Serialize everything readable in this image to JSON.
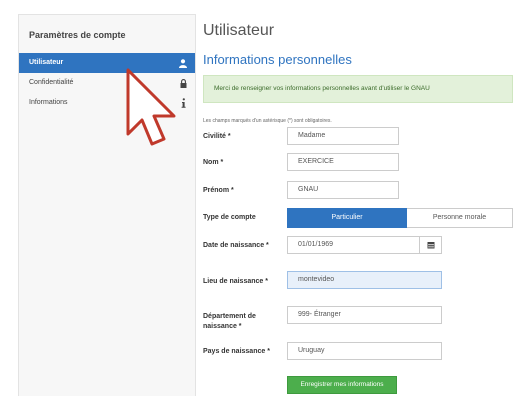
{
  "sidebar": {
    "title": "Paramètres de compte",
    "items": [
      {
        "label": "Utilisateur",
        "icon": "user-icon",
        "active": true
      },
      {
        "label": "Confidentialité",
        "icon": "lock-icon",
        "active": false
      },
      {
        "label": "Informations",
        "icon": "info-icon",
        "active": false
      }
    ]
  },
  "main": {
    "title": "Utilisateur",
    "section": "Informations personnelles",
    "alert": "Merci de renseigner vos informations personnelles avant d'utiliser le GNAU",
    "required_note": "Les champs marqués d'un astérisque (*) sont obligatoires."
  },
  "form": {
    "civilite": {
      "label": "Civilité *",
      "value": "Madame"
    },
    "nom": {
      "label": "Nom *",
      "value": "EXERCICE"
    },
    "prenom": {
      "label": "Prénom *",
      "value": "GNAU"
    },
    "type_compte": {
      "label": "Type de compte",
      "options": [
        "Particulier",
        "Personne morale"
      ],
      "selected": "Particulier"
    },
    "date_naissance": {
      "label": "Date de naissance *",
      "value": "01/01/1969"
    },
    "lieu_naissance": {
      "label": "Lieu de naissance *",
      "value": "montevideo"
    },
    "departement": {
      "label": "Département de naissance *",
      "value": "999- Étranger"
    },
    "pays": {
      "label": "Pays de naissance *",
      "value": "Uruguay"
    }
  },
  "actions": {
    "submit": "Enregistrer mes informations"
  },
  "colors": {
    "primary": "#2f74c0",
    "success": "#4cae4c",
    "alert_bg": "#e3f1da",
    "cursor": "#c0392b"
  }
}
